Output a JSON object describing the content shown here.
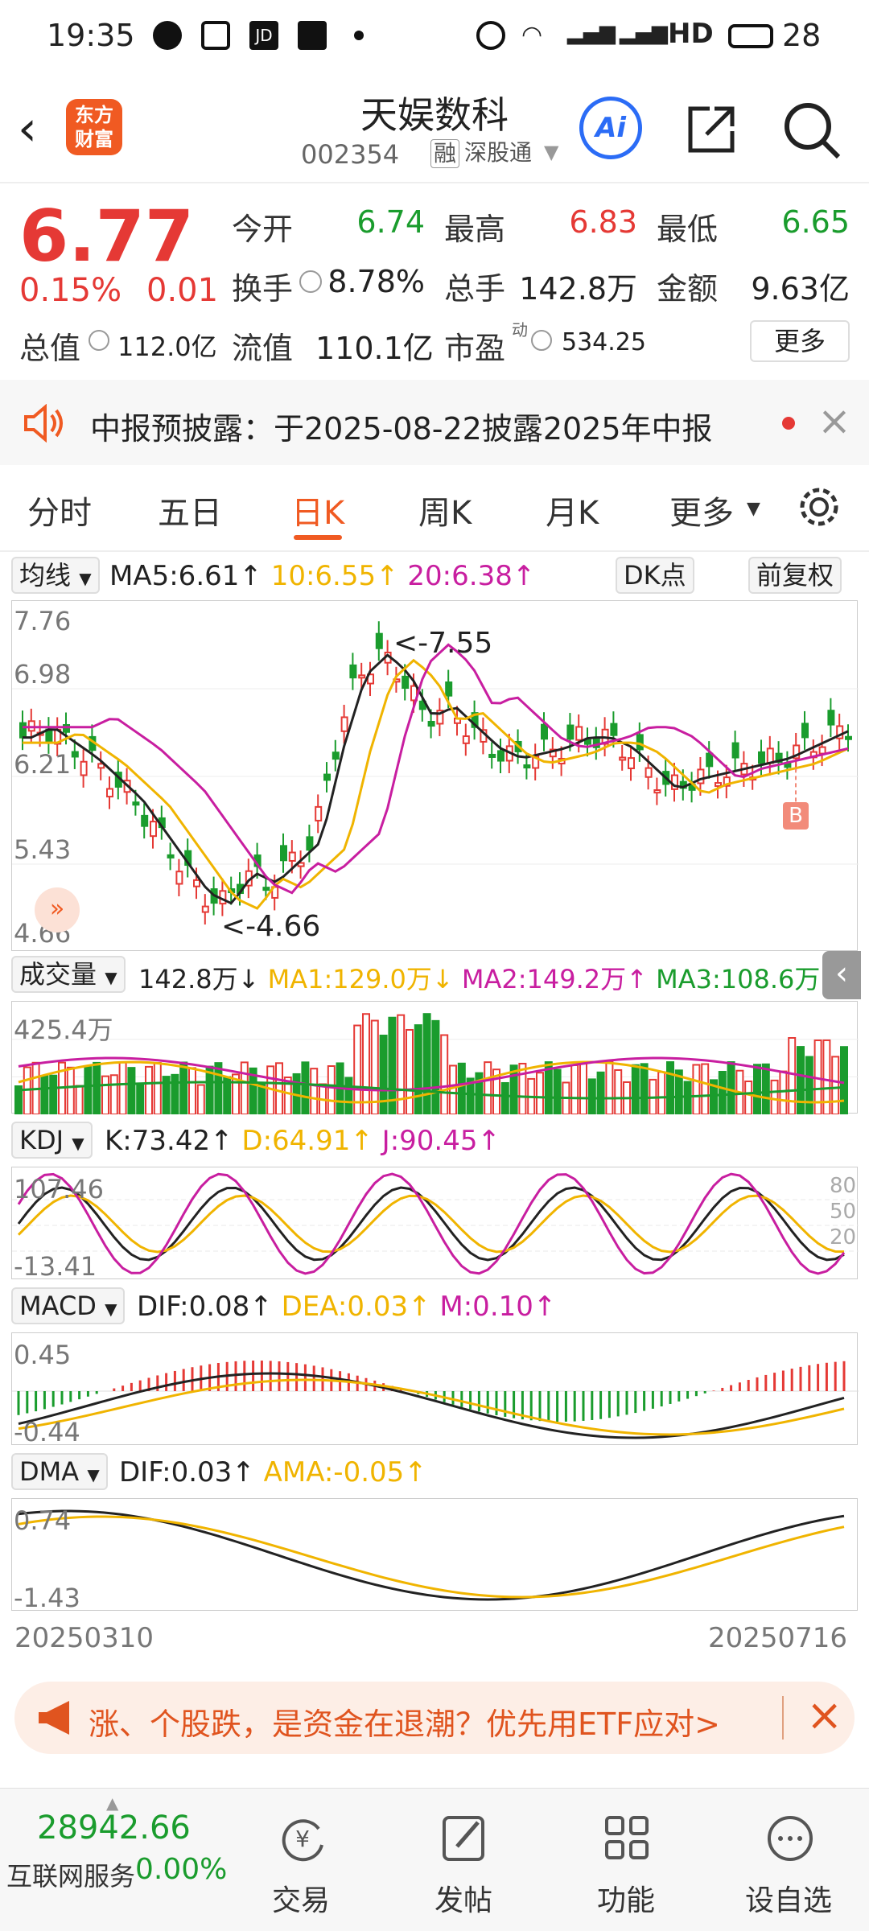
{
  "status_bar": {
    "time": "19:35",
    "network": "HD",
    "battery": "28"
  },
  "header": {
    "logo_text_1": "东方",
    "logo_text_2": "财富",
    "stock_name": "天娱数科",
    "stock_code": "002354",
    "tag_margin": "融",
    "tag_connect": "深股通",
    "ai_label": "Ai"
  },
  "quote": {
    "price": "6.77",
    "change_pct": "0.15%",
    "change_amt": "0.01",
    "open_label": "今开",
    "open": "6.74",
    "high_label": "最高",
    "high": "6.83",
    "low_label": "最低",
    "low": "6.65",
    "turnover_label": "换手",
    "turnover": "8.78%",
    "volume_label": "总手",
    "volume": "142.8万",
    "amount_label": "金额",
    "amount": "9.63亿",
    "mcap_label": "总值",
    "mcap": "112.0亿",
    "float_label": "流值",
    "float": "110.1亿",
    "pe_label": "市盈",
    "pe_sup": "动",
    "pe": "534.25",
    "more_label": "更多"
  },
  "notice": {
    "text": "中报预披露：于2025-08-22披露2025年中报"
  },
  "tabs": [
    {
      "label": "分时"
    },
    {
      "label": "五日"
    },
    {
      "label": "日K"
    },
    {
      "label": "周K"
    },
    {
      "label": "月K"
    },
    {
      "label": "更多"
    }
  ],
  "kline": {
    "selector": "均线",
    "ma5": "MA5:6.61↑",
    "ma10": "10:6.55↑",
    "ma20": "20:6.38↑",
    "dk_label": "DK点",
    "adjust_label": "前复权",
    "y_ticks": [
      "7.76",
      "6.98",
      "6.21",
      "5.43",
      "4.66"
    ],
    "high_mark": "<-7.55",
    "low_mark": "<-4.66",
    "buy_marker": "B"
  },
  "volume_panel": {
    "selector": "成交量",
    "vol": "142.8万↓",
    "ma1": "MA1:129.0万↓",
    "ma2": "MA2:149.2万↑",
    "ma3": "MA3:108.6万↑",
    "max_label": "425.4万"
  },
  "kdj_panel": {
    "selector": "KDJ",
    "k": "K:73.42↑",
    "d": "D:64.91↑",
    "j": "J:90.45↑",
    "top": "107.46",
    "bottom": "-13.41",
    "ref_80": "80",
    "ref_50": "50",
    "ref_20": "20"
  },
  "macd_panel": {
    "selector": "MACD",
    "dif": "DIF:0.08↑",
    "dea": "DEA:0.03↑",
    "m": "M:0.10↑",
    "top": "0.45",
    "bottom": "-0.44"
  },
  "dma_panel": {
    "selector": "DMA",
    "dif": "DIF:0.03↑",
    "ama": "AMA:-0.05↑",
    "top": "0.74",
    "bottom": "-1.43"
  },
  "date_range": {
    "start": "20250310",
    "end": "20250716"
  },
  "banner": {
    "text": "涨、个股跌，是资金在退潮？优先用ETF应对>"
  },
  "bottom_nav": {
    "index_value": "28942.66",
    "index_name": "互联网服务",
    "index_change": "0.00%",
    "items": [
      {
        "label": "交易"
      },
      {
        "label": "发帖"
      },
      {
        "label": "功能"
      },
      {
        "label": "设自选"
      }
    ]
  },
  "colors": {
    "up": "#e53935",
    "down": "#1a9c2d",
    "brand": "#f05a22",
    "ma10": "#f0b400",
    "ma20": "#c81ea0"
  }
}
